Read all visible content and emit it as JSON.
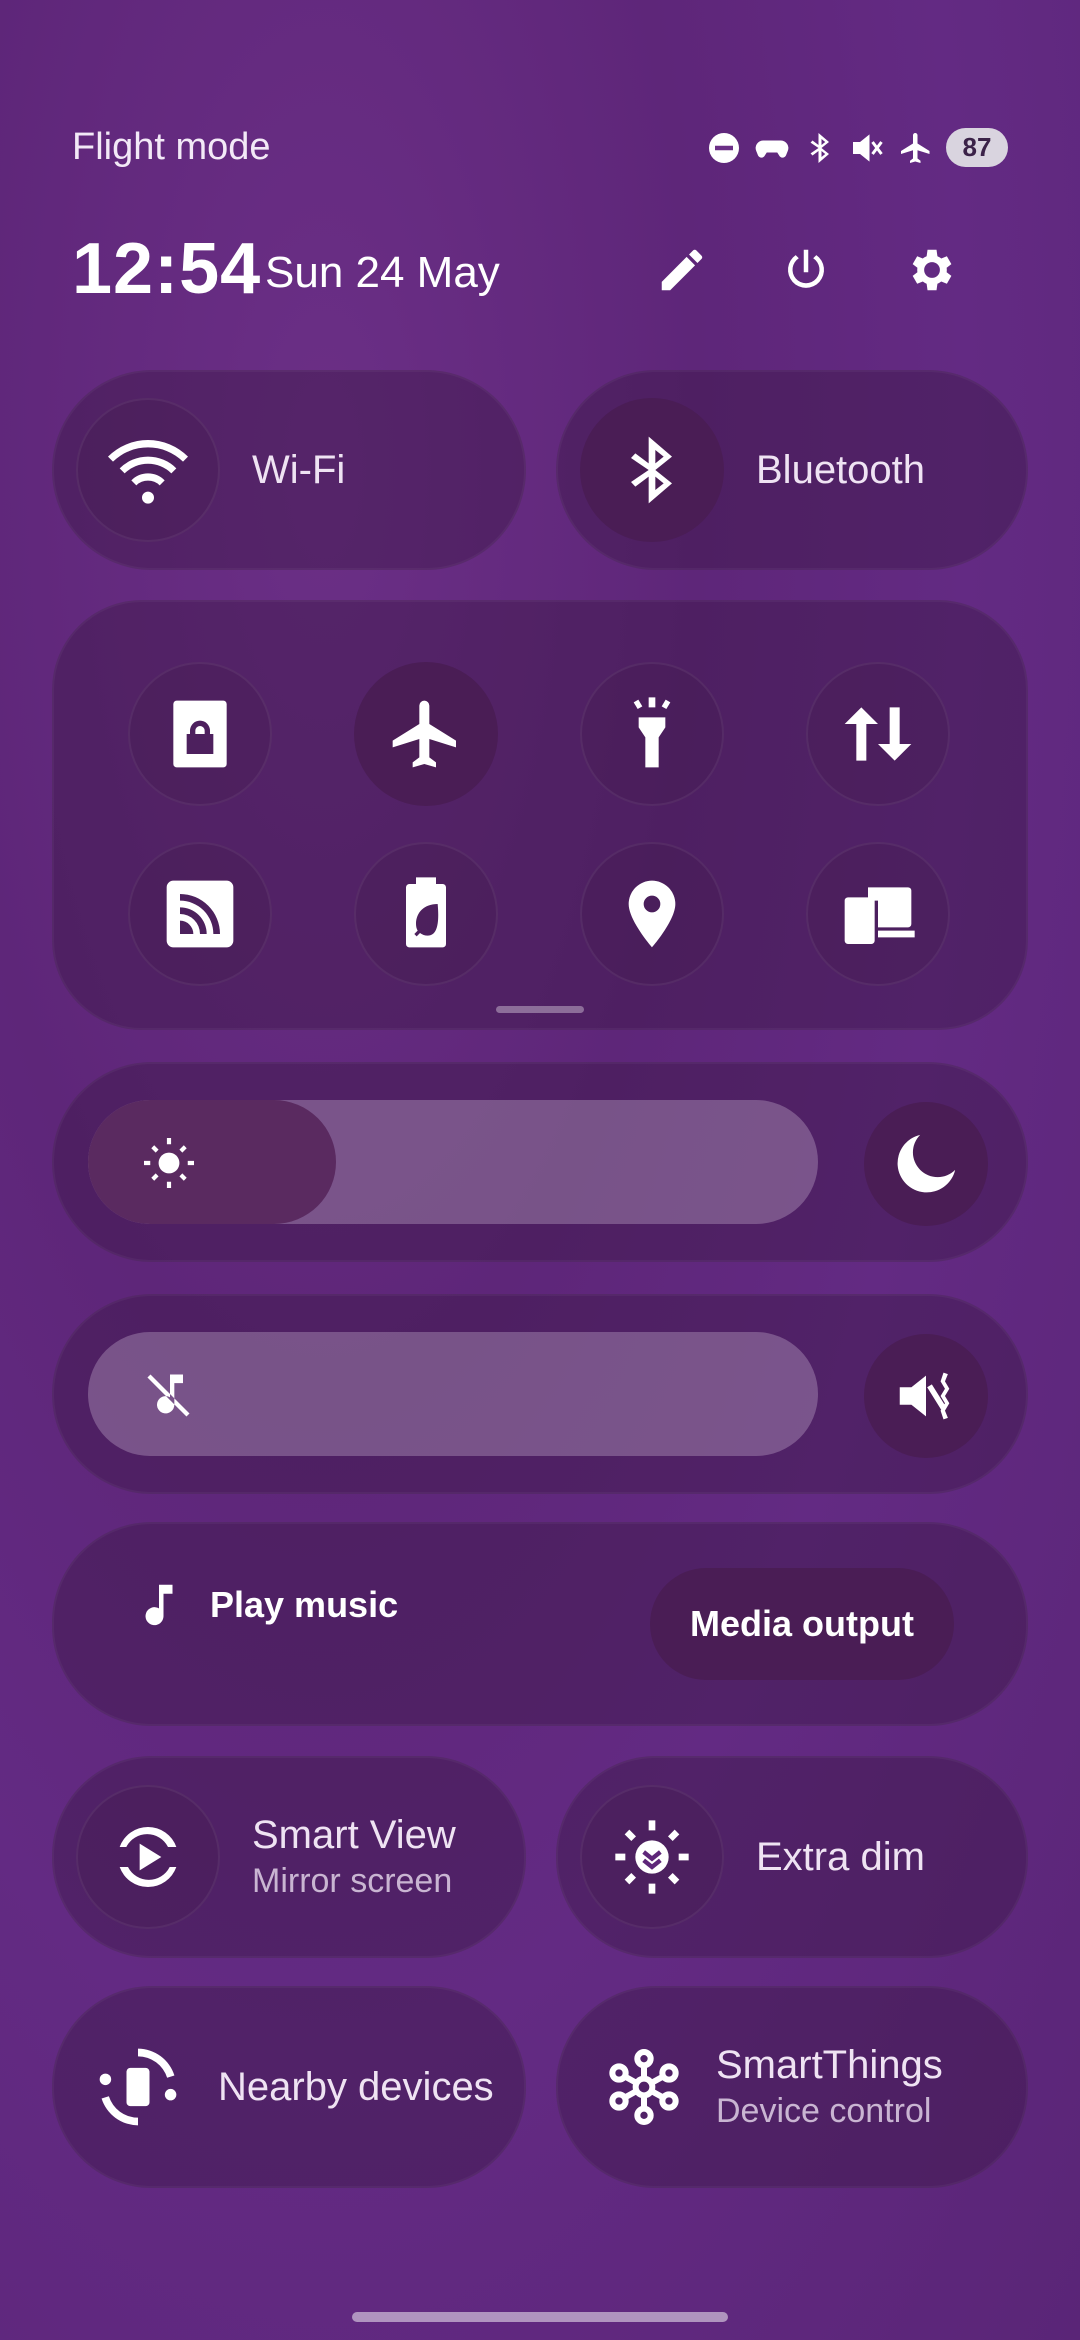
{
  "status_bar": {
    "mode_label": "Flight mode",
    "battery": "87",
    "icons": [
      "dnd-icon",
      "gamepad-icon",
      "bluetooth-icon",
      "mute-icon",
      "airplane-icon"
    ]
  },
  "header": {
    "time": "12:54",
    "date": "Sun 24 May",
    "actions": [
      "edit-icon",
      "power-icon",
      "settings-icon"
    ]
  },
  "tiles_top": [
    {
      "label": "Wi-Fi",
      "icon": "wifi-icon",
      "active": false
    },
    {
      "label": "Bluetooth",
      "icon": "bluetooth-icon",
      "active": true
    }
  ],
  "quick_toggles": [
    {
      "name": "screen-lock-icon",
      "active": false
    },
    {
      "name": "airplane-mode-icon",
      "active": true
    },
    {
      "name": "flashlight-icon",
      "active": false
    },
    {
      "name": "mobile-data-icon",
      "active": false
    },
    {
      "name": "cast-icon",
      "active": false
    },
    {
      "name": "power-saving-icon",
      "active": false
    },
    {
      "name": "location-icon",
      "active": false
    },
    {
      "name": "device-connect-icon",
      "active": false
    }
  ],
  "brightness": {
    "level": 0.34,
    "icon": "sun-icon",
    "end_icon": "night-mode-icon"
  },
  "volume": {
    "level": 0.0,
    "icon": "muted-note-icon",
    "end_icon": "vibrate-off-icon"
  },
  "media": {
    "play_label": "Play music",
    "output_label": "Media output"
  },
  "tiles_bottom": [
    {
      "label": "Smart View",
      "sub": "Mirror screen",
      "icon": "smart-view-icon"
    },
    {
      "label": "Extra dim",
      "sub": "",
      "icon": "extra-dim-icon"
    },
    {
      "label": "Nearby devices",
      "sub": "",
      "icon": "nearby-devices-icon"
    },
    {
      "label": "SmartThings",
      "sub": "Device control",
      "icon": "smartthings-icon"
    }
  ]
}
